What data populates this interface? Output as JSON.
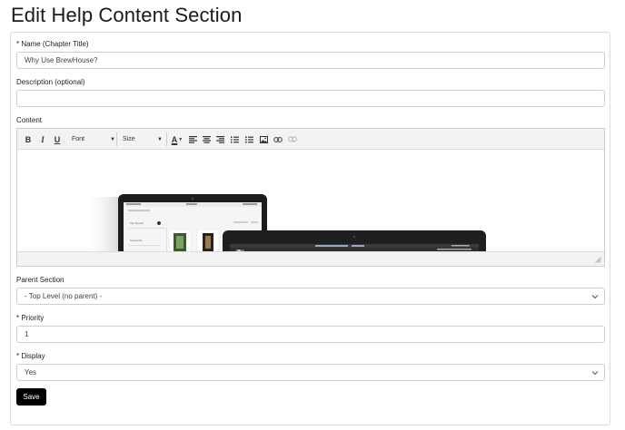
{
  "page": {
    "title": "Edit Help Content Section"
  },
  "form": {
    "name": {
      "label": "* Name (Chapter Title)",
      "value": "Why Use BrewHouse?"
    },
    "description": {
      "label": "Description (optional)",
      "value": ""
    },
    "content": {
      "label": "Content",
      "toolbar": {
        "bold": "B",
        "italic": "I",
        "underline": "U",
        "font": "Font",
        "size": "Size",
        "text_color": "A"
      },
      "image_tablet_text": {
        "back": "Tap Search",
        "keyword": "Keywords"
      }
    },
    "parent": {
      "label": "Parent Section",
      "value": "- Top Level (no parent) -"
    },
    "priority": {
      "label": "* Priority",
      "value": "1"
    },
    "display": {
      "label": "* Display",
      "value": "Yes"
    },
    "save_label": "Save"
  }
}
